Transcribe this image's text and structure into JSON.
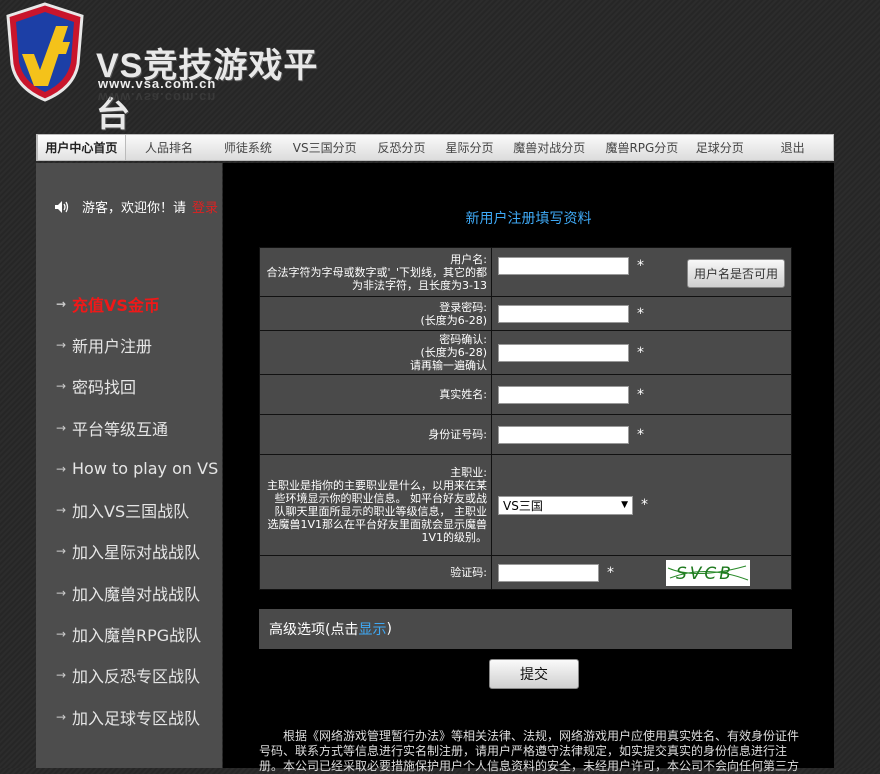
{
  "header": {
    "logo_title": "VS竞技游戏平台",
    "logo_url": "www.vsa.com.cn"
  },
  "nav": {
    "items": [
      {
        "label": "用户中心首页",
        "active": true
      },
      {
        "label": "人品排名"
      },
      {
        "label": "师徒系统"
      },
      {
        "label": "VS三国分页"
      },
      {
        "label": "反恐分页"
      },
      {
        "label": "星际分页"
      },
      {
        "label": "魔兽对战分页"
      },
      {
        "label": "魔兽RPG分页"
      },
      {
        "label": "足球分页"
      },
      {
        "label": "退出"
      }
    ]
  },
  "sidebar": {
    "greeting": "游客，欢迎你！请",
    "login": "登录",
    "greeting_end": "！",
    "items": [
      {
        "label": "充值VS金币",
        "highlight": true
      },
      {
        "label": "新用户注册"
      },
      {
        "label": "密码找回"
      },
      {
        "label": "平台等级互通"
      },
      {
        "label": "How to play on VS"
      },
      {
        "label": "加入VS三国战队"
      },
      {
        "label": "加入星际对战战队"
      },
      {
        "label": "加入魔兽对战战队"
      },
      {
        "label": "加入魔兽RPG战队"
      },
      {
        "label": "加入反恐专区战队"
      },
      {
        "label": "加入足球专区战队"
      }
    ]
  },
  "form": {
    "title": "新用户注册填写资料",
    "username_label": "用户名:",
    "username_hint": "合法字符为字母或数字或'_'下划线，其它的都为非法字符，且长度为3-13",
    "check_button": "用户名是否可用",
    "password_label": "登录密码:",
    "password_hint": "(长度为6-28)",
    "confirm_label": "密码确认:",
    "confirm_hint": "(长度为6-28)",
    "confirm_hint2": "请再输一遍确认",
    "realname_label": "真实姓名:",
    "idcard_label": "身份证号码:",
    "profession_label": "主职业:",
    "profession_hint": "主职业是指你的主要职业是什么，以用来在某些环境显示你的职业信息。 如平台好友或战队聊天里面所显示的职业等级信息， 主职业选魔兽1V1那么在平台好友里面就会显示魔兽1V1的级别。",
    "profession_value": "VS三国",
    "captcha_label": "验证码:",
    "captcha_text": "SVCB",
    "required_mark": "*",
    "advanced_prefix": "高级选项(点击",
    "advanced_link": "显示",
    "advanced_suffix": ")",
    "submit": "提交",
    "notice": "根据《网络游戏管理暂行办法》等相关法律、法规，网络游戏用户应使用真实姓名、有效身份证件号码、联系方式等信息进行实名制注册，请用户严格遵守法律规定，如实提交真实的身份信息进行注册。本公司已经采取必要措施保护用户个人信息资料的安全，未经用户许可，本公司不会向任何第三方"
  }
}
